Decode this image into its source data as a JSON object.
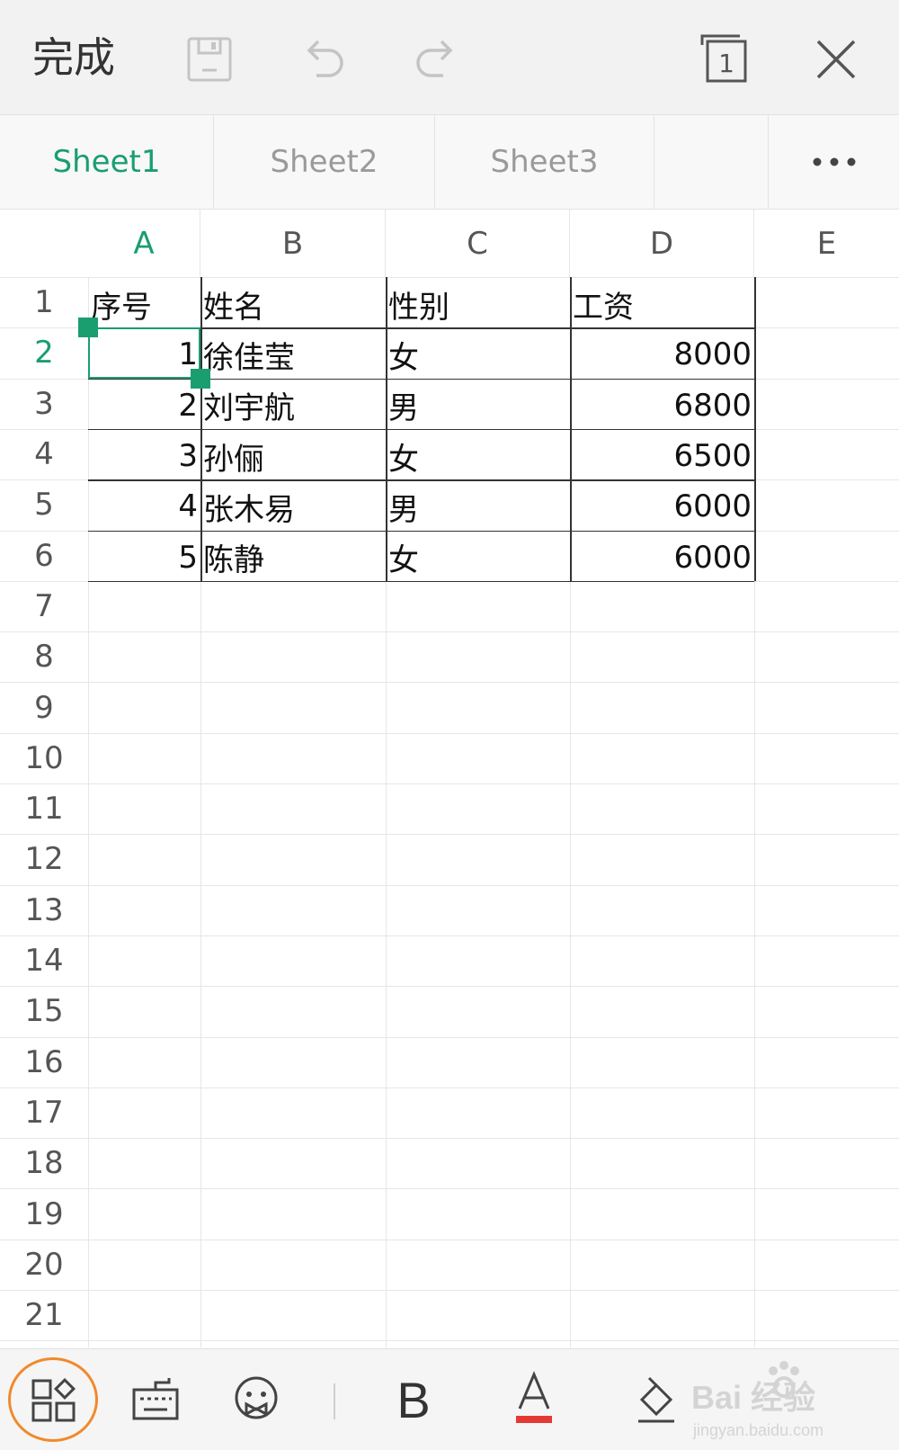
{
  "toolbar": {
    "done_label": "完成",
    "page_indicator": "1"
  },
  "sheet_tabs": [
    {
      "label": "Sheet1",
      "active": true
    },
    {
      "label": "Sheet2",
      "active": false
    },
    {
      "label": "Sheet3",
      "active": false
    }
  ],
  "more_label": "•••",
  "columns": [
    "A",
    "B",
    "C",
    "D",
    "E"
  ],
  "rows": [
    "1",
    "2",
    "3",
    "4",
    "5",
    "6",
    "7",
    "8",
    "9",
    "10",
    "11",
    "12",
    "13",
    "14",
    "15",
    "16",
    "17",
    "18",
    "19",
    "20",
    "21"
  ],
  "table": {
    "header": [
      "序号",
      "姓名",
      "性别",
      "工资"
    ],
    "data": [
      [
        "1",
        "徐佳莹",
        "女",
        "8000"
      ],
      [
        "2",
        "刘宇航",
        "男",
        "6800"
      ],
      [
        "3",
        "孙俪",
        "女",
        "6500"
      ],
      [
        "4",
        "张木易",
        "男",
        "6000"
      ],
      [
        "5",
        "陈静",
        "女",
        "6000"
      ]
    ]
  },
  "selection": {
    "cell": "A2",
    "active_column": "A",
    "active_row": "2"
  },
  "bottom_toolbar": {
    "bold_label": "B",
    "font_color_label": "A",
    "font_color": "#e53935",
    "highlight_color": "#f08a2c"
  },
  "watermark": {
    "brand": "Bai 经验",
    "url": "jingyan.baidu.com"
  },
  "colors": {
    "accent": "#1a9e6f",
    "toolbar_bg": "#f2f2f2"
  }
}
